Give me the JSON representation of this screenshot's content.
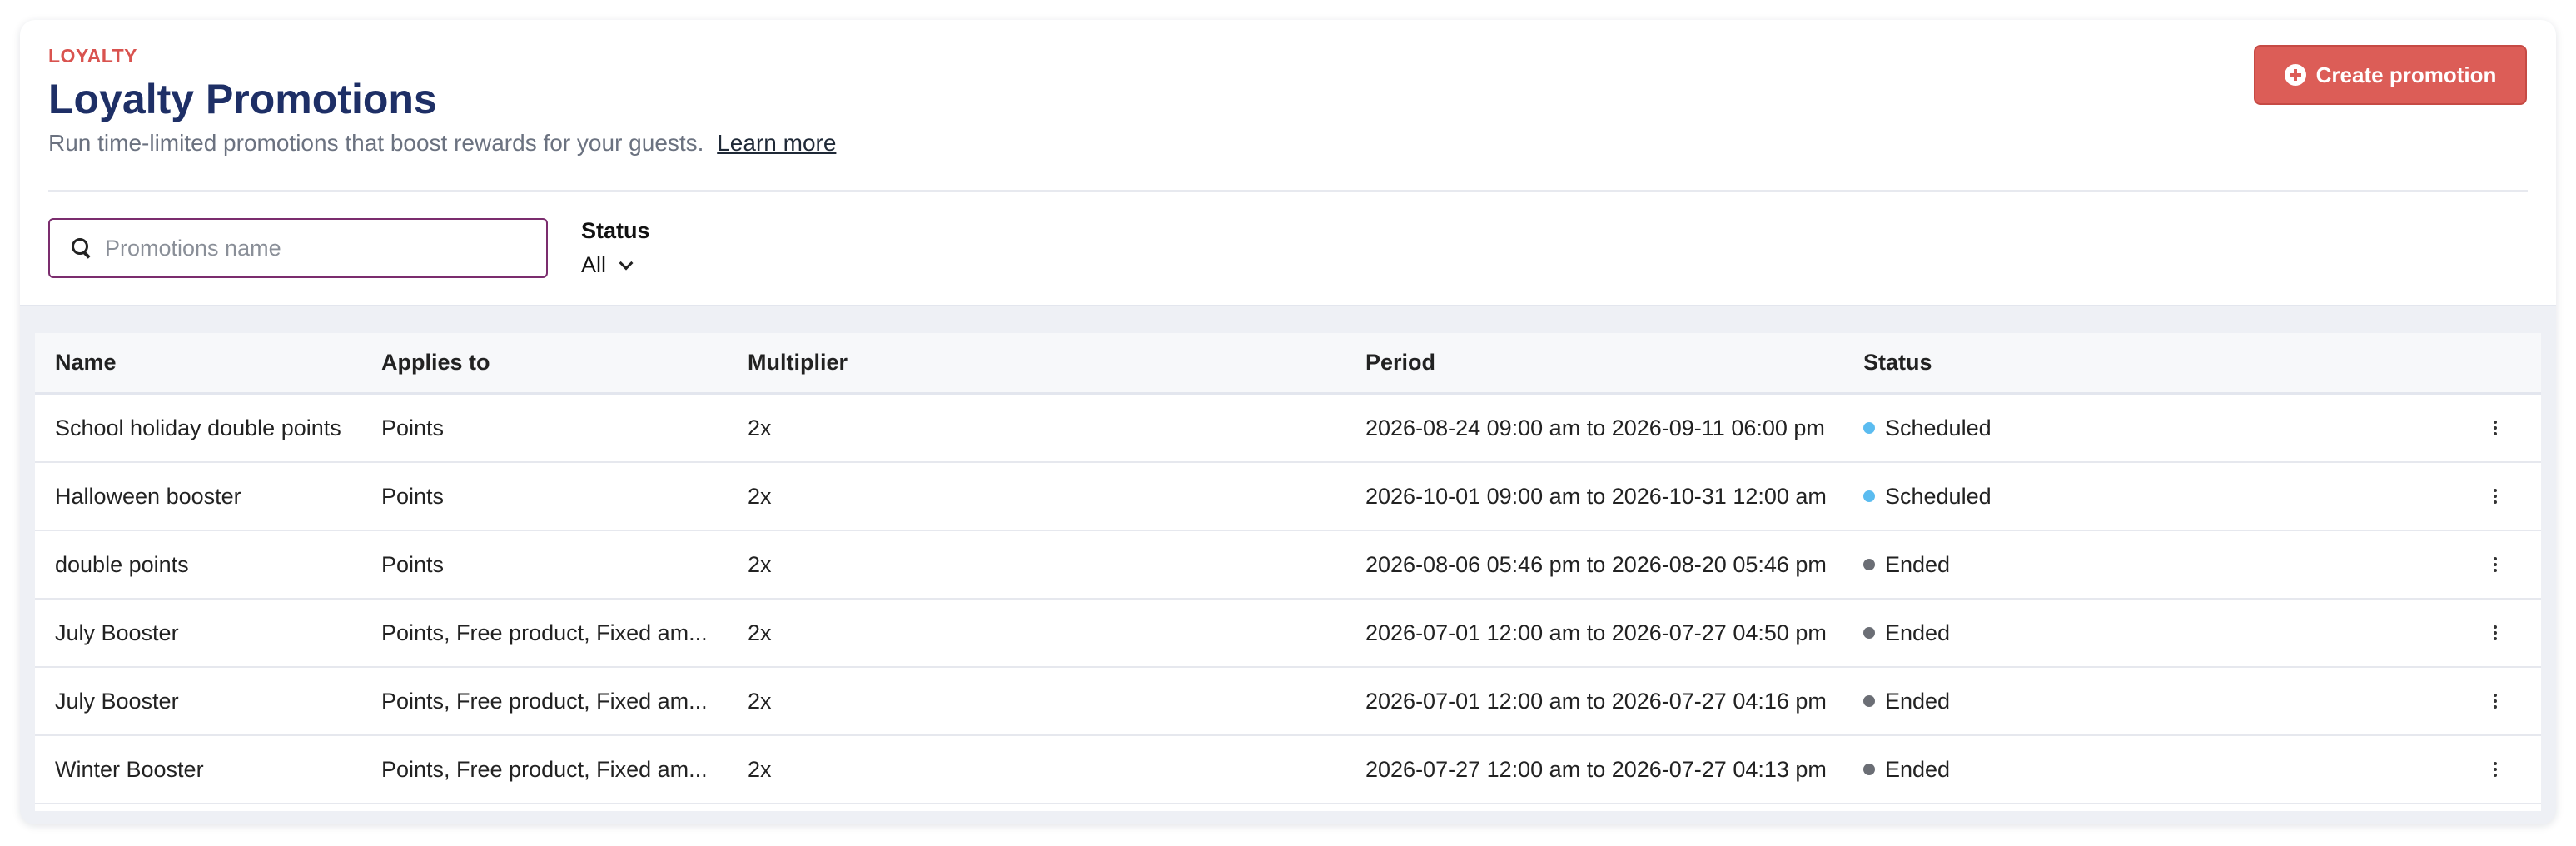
{
  "header": {
    "eyebrow": "LOYALTY",
    "title": "Loyalty Promotions",
    "subtitle": "Run time-limited promotions that boost rewards for your guests.",
    "learn_more": "Learn more",
    "create_button": "Create promotion"
  },
  "filters": {
    "search_placeholder": "Promotions name",
    "status_label": "Status",
    "status_value": "All"
  },
  "table": {
    "columns": [
      "Name",
      "Applies to",
      "Multiplier",
      "Period",
      "Status"
    ],
    "rows": [
      {
        "name": "School holiday double points",
        "applies_to": "Points",
        "multiplier": "2x",
        "period": "2026-08-24 09:00 am to 2026-09-11 06:00 pm",
        "status": "Scheduled"
      },
      {
        "name": "Halloween booster",
        "applies_to": "Points",
        "multiplier": "2x",
        "period": "2026-10-01 09:00 am to 2026-10-31 12:00 am",
        "status": "Scheduled"
      },
      {
        "name": "double points",
        "applies_to": "Points",
        "multiplier": "2x",
        "period": "2026-08-06 05:46 pm to 2026-08-20 05:46 pm",
        "status": "Ended"
      },
      {
        "name": "July Booster",
        "applies_to": "Points, Free product, Fixed am...",
        "multiplier": "2x",
        "period": "2026-07-01 12:00 am to 2026-07-27 04:50 pm",
        "status": "Ended"
      },
      {
        "name": "July Booster",
        "applies_to": "Points, Free product, Fixed am...",
        "multiplier": "2x",
        "period": "2026-07-01 12:00 am to 2026-07-27 04:16 pm",
        "status": "Ended"
      },
      {
        "name": "Winter Booster",
        "applies_to": "Points, Free product, Fixed am...",
        "multiplier": "2x",
        "period": "2026-07-27 12:00 am to 2026-07-27 04:13 pm",
        "status": "Ended"
      }
    ]
  },
  "colors": {
    "accent": "#dc5d57",
    "title": "#1e2f66",
    "scheduled": "#5bbcf0",
    "ended": "#6b6e75"
  },
  "icons": {
    "create": "plus-circle-icon",
    "search": "search-icon",
    "dropdown": "chevron-down-icon",
    "row_menu": "more-vertical-icon"
  }
}
